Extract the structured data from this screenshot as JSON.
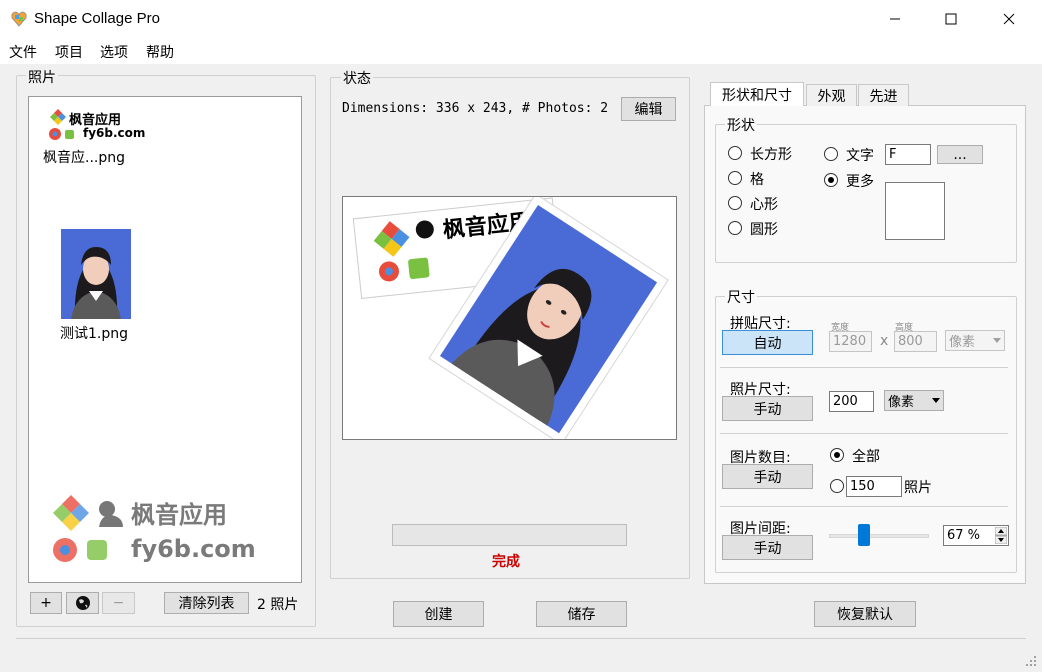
{
  "window": {
    "title": "Shape Collage Pro"
  },
  "menu": [
    "文件",
    "项目",
    "选项",
    "帮助"
  ],
  "photos": {
    "label": "照片",
    "items": [
      {
        "name": "枫音应...png",
        "logo_text": "枫音应用",
        "logo_sub": "fy6b.com"
      },
      {
        "name": "测试1.png"
      }
    ],
    "watermark_top": "枫音应用",
    "watermark_bottom": "fy6b.com",
    "add_label": "+",
    "remove_label": "−",
    "clear_label": "清除列表",
    "count_text": "2  照片"
  },
  "status": {
    "label": "状态",
    "dimensions": "Dimensions: 336 x 243, # Photos: 2",
    "edit_label": "编辑",
    "done_label": "完成",
    "progress": 0
  },
  "buttons": {
    "create": "创建",
    "save": "储存",
    "reset": "恢复默认"
  },
  "tabs": [
    "形状和尺寸",
    "外观",
    "先进"
  ],
  "shape": {
    "label": "形状",
    "options": [
      "长方形",
      "格",
      "心形",
      "圆形"
    ],
    "text_label": "文字",
    "text_value": "F",
    "more_label": "更多",
    "browse_label": "..."
  },
  "size": {
    "label": "尺寸",
    "collage_size_label": "拼贴尺寸:",
    "collage_button": "自动",
    "width_caption": "宽度",
    "height_caption": "高度",
    "width_value": "1280",
    "x_sep": "x",
    "height_value": "800",
    "unit_disabled": "像素",
    "photo_size_label": "照片尺寸:",
    "photo_button": "手动",
    "photo_size_value": "200",
    "photo_unit": "像素",
    "count_label": "图片数目:",
    "count_button": "手动",
    "all_label": "全部",
    "count_value": "150",
    "count_unit": "照片",
    "spacing_label": "图片间距:",
    "spacing_button": "手动",
    "spacing_value": "67 %",
    "spacing_percent": 0.33
  },
  "colors": {
    "accent": "#3b8fd9",
    "done": "#cc0000",
    "selected_button": "#cce4f7"
  }
}
